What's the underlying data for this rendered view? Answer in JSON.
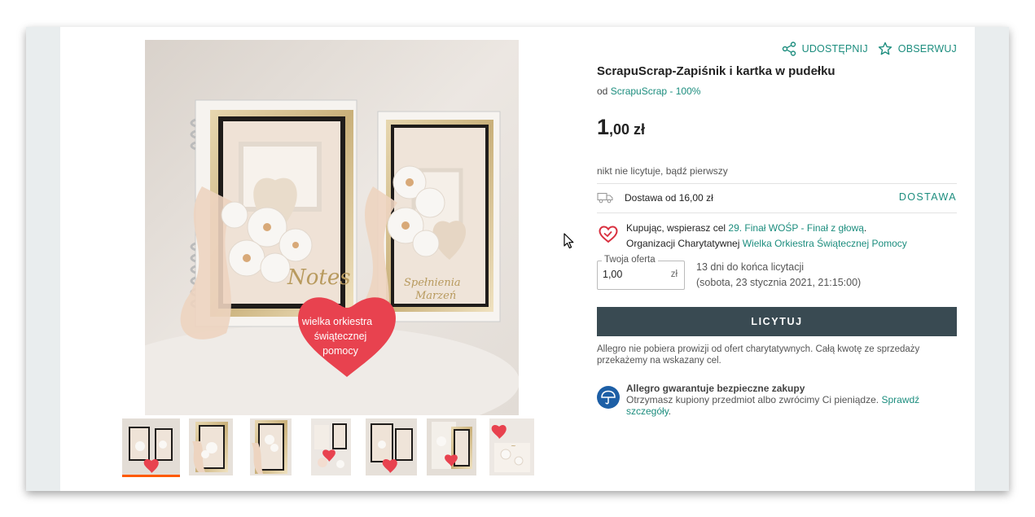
{
  "actions": {
    "share_label": "UDOSTĘPNIJ",
    "watch_label": "OBSERWUJ"
  },
  "product": {
    "title": "ScrapuScrap-Zapiśnik i kartka w pudełku",
    "seller_prefix": "od",
    "seller_name": "ScrapuScrap - 100%",
    "price_integer": "1",
    "price_decimal": ",00 zł",
    "bids_status": "nikt nie licytuje, bądź pierwszy"
  },
  "delivery": {
    "text": "Dostawa od 16,00 zł",
    "link_label": "DOSTAWA"
  },
  "charity": {
    "line1_prefix": "Kupując, wspierasz cel",
    "line1_link": "29. Finał WOŚP - Finał z głową",
    "line1_suffix": ".",
    "line2_prefix": "Organizacji Charytatywnej",
    "line2_link": "Wielka Orkiestra Świątecznej Pomocy"
  },
  "offer": {
    "legend": "Twoja oferta",
    "value": "1,00",
    "unit": "zł",
    "time_left": "13 dni do końca licytacji",
    "end_date": "(sobota, 23 stycznia 2021, 21:15:00)"
  },
  "bid_button_label": "LICYTUJ",
  "note": "Allegro nie pobiera prowizji od ofert charytatywnych. Całą kwotę ze sprzedaży przekażemy na wskazany cel.",
  "guarantee": {
    "title": "Allegro gwarantuje bezpieczne zakupy",
    "text": "Otrzymasz kupiony przedmiot albo zwrócimy Ci pieniądze.",
    "link": "Sprawdź szczegóły",
    "suffix": "."
  },
  "gallery": {
    "heart_text": [
      "wielka orkiestra",
      "świątecznej",
      "pomocy"
    ],
    "notebook_text": "Notes",
    "card_text": [
      "Spełnienia",
      "Marzeń"
    ],
    "thumbnail_count": 7,
    "active_thumbnail": 1
  },
  "colors": {
    "accent": "#1c8d7e",
    "button": "#394a52",
    "active_thumb": "#ff5a00",
    "heart": "#e8424f"
  }
}
